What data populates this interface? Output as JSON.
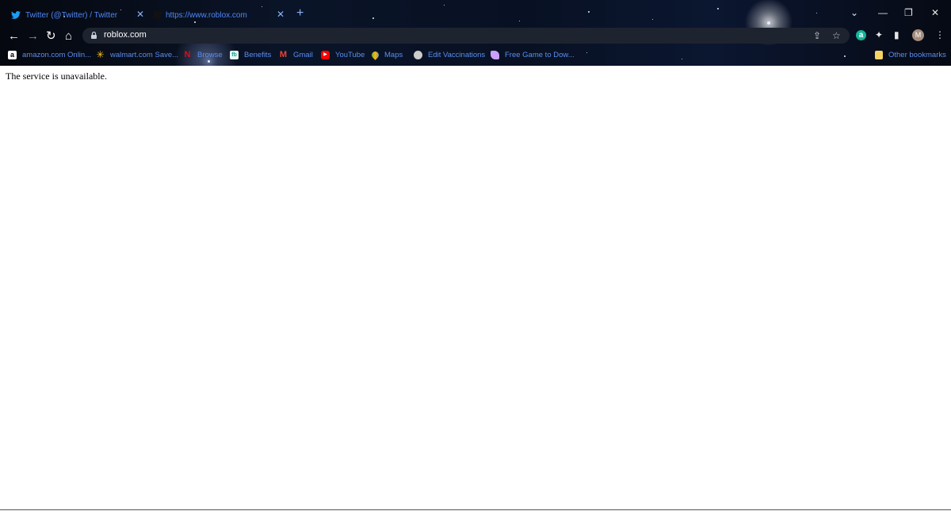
{
  "tabs": [
    {
      "title": "Twitter (@Twitter) / Twitter",
      "icon": "twitter-icon"
    },
    {
      "title": "https://www.roblox.com",
      "icon": "roblox-icon"
    }
  ],
  "new_tab_symbol": "+",
  "window_controls": {
    "tab_search": "⌄",
    "minimize": "—",
    "restore": "❐",
    "close": "✕"
  },
  "toolbar": {
    "back": "←",
    "forward": "→",
    "reload": "↻",
    "home": "⌂",
    "url": "roblox.com",
    "share": "⇪",
    "star": "☆",
    "extension_a": "a",
    "extensions": "✦",
    "sidepanel": "▮",
    "profile": "M",
    "menu": "⋮"
  },
  "bookmarks": [
    {
      "label": "amazon.com Onlin...",
      "icon": "amazon-icon",
      "color": "#ffffff"
    },
    {
      "label": "walmart.com Save...",
      "icon": "walmart-icon",
      "color": "#ffc220"
    },
    {
      "label": "Browse",
      "icon": "netflix-icon",
      "color": "#e50914"
    },
    {
      "label": "Benefits",
      "icon": "benefits-icon",
      "color": "#1aa3a3"
    },
    {
      "label": "Gmail",
      "icon": "gmail-icon",
      "color": "#ea4335"
    },
    {
      "label": "YouTube",
      "icon": "youtube-icon",
      "color": "#ff0000"
    },
    {
      "label": "Maps",
      "icon": "maps-icon",
      "color": "#34a853"
    },
    {
      "label": "Edit Vaccinations",
      "icon": "globe-icon",
      "color": "#cccccc"
    },
    {
      "label": "Free Game to Dow...",
      "icon": "game-icon",
      "color": "#c9a0ff"
    }
  ],
  "other_bookmarks": "Other bookmarks",
  "page": {
    "message": "The service is unavailable."
  }
}
